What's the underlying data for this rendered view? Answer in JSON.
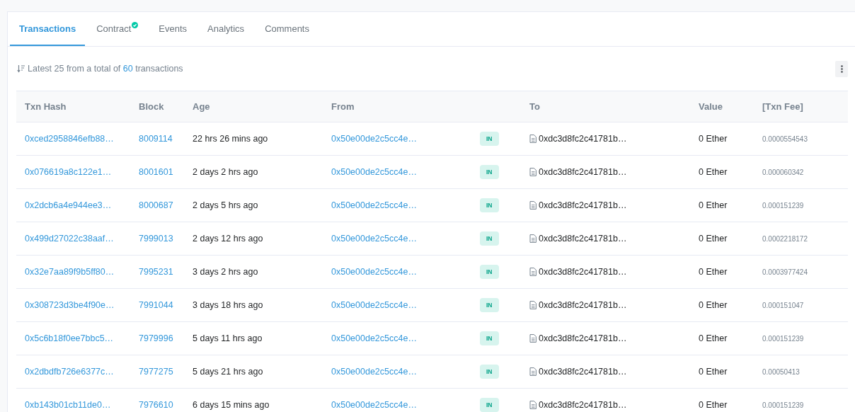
{
  "tabs": [
    {
      "label": "Transactions",
      "selected": true,
      "verified": false
    },
    {
      "label": "Contract",
      "selected": false,
      "verified": true
    },
    {
      "label": "Events",
      "selected": false,
      "verified": false
    },
    {
      "label": "Analytics",
      "selected": false,
      "verified": false
    },
    {
      "label": "Comments",
      "selected": false,
      "verified": false
    }
  ],
  "summary": {
    "before": "Latest 25 from a total of",
    "count": "60",
    "after": "transactions"
  },
  "table": {
    "columns": [
      "Txn Hash",
      "Block",
      "Age",
      "From",
      "",
      "To",
      "Value",
      "[Txn Fee]"
    ],
    "rows": [
      {
        "hash": "0xced2958846efb88…",
        "block": "8009114",
        "age": "22 hrs 26 mins ago",
        "from": "0x50e00de2c5cc4e…",
        "direction": "IN",
        "to": "0xdc3d8fc2c41781b…",
        "value": "0 Ether",
        "fee": "0.0000554543"
      },
      {
        "hash": "0x076619a8c122e1…",
        "block": "8001601",
        "age": "2 days 2 hrs ago",
        "from": "0x50e00de2c5cc4e…",
        "direction": "IN",
        "to": "0xdc3d8fc2c41781b…",
        "value": "0 Ether",
        "fee": "0.000060342"
      },
      {
        "hash": "0x2dcb6a4e944ee3…",
        "block": "8000687",
        "age": "2 days 5 hrs ago",
        "from": "0x50e00de2c5cc4e…",
        "direction": "IN",
        "to": "0xdc3d8fc2c41781b…",
        "value": "0 Ether",
        "fee": "0.000151239"
      },
      {
        "hash": "0x499d27022c38aaf…",
        "block": "7999013",
        "age": "2 days 12 hrs ago",
        "from": "0x50e00de2c5cc4e…",
        "direction": "IN",
        "to": "0xdc3d8fc2c41781b…",
        "value": "0 Ether",
        "fee": "0.0002218172"
      },
      {
        "hash": "0x32e7aa89f9b5ff80…",
        "block": "7995231",
        "age": "3 days 2 hrs ago",
        "from": "0x50e00de2c5cc4e…",
        "direction": "IN",
        "to": "0xdc3d8fc2c41781b…",
        "value": "0 Ether",
        "fee": "0.0003977424"
      },
      {
        "hash": "0x308723d3be4f90e…",
        "block": "7991044",
        "age": "3 days 18 hrs ago",
        "from": "0x50e00de2c5cc4e…",
        "direction": "IN",
        "to": "0xdc3d8fc2c41781b…",
        "value": "0 Ether",
        "fee": "0.000151047"
      },
      {
        "hash": "0x5c6b18f0ee7bbc5…",
        "block": "7979996",
        "age": "5 days 11 hrs ago",
        "from": "0x50e00de2c5cc4e…",
        "direction": "IN",
        "to": "0xdc3d8fc2c41781b…",
        "value": "0 Ether",
        "fee": "0.000151239"
      },
      {
        "hash": "0x2dbdfb726e6377c…",
        "block": "7977275",
        "age": "5 days 21 hrs ago",
        "from": "0x50e00de2c5cc4e…",
        "direction": "IN",
        "to": "0xdc3d8fc2c41781b…",
        "value": "0 Ether",
        "fee": "0.00050413"
      },
      {
        "hash": "0xb143b01cb11de0…",
        "block": "7976610",
        "age": "6 days 15 mins ago",
        "from": "0x50e00de2c5cc4e…",
        "direction": "IN",
        "to": "0xdc3d8fc2c41781b…",
        "value": "0 Ether",
        "fee": "0.000151239"
      }
    ]
  }
}
